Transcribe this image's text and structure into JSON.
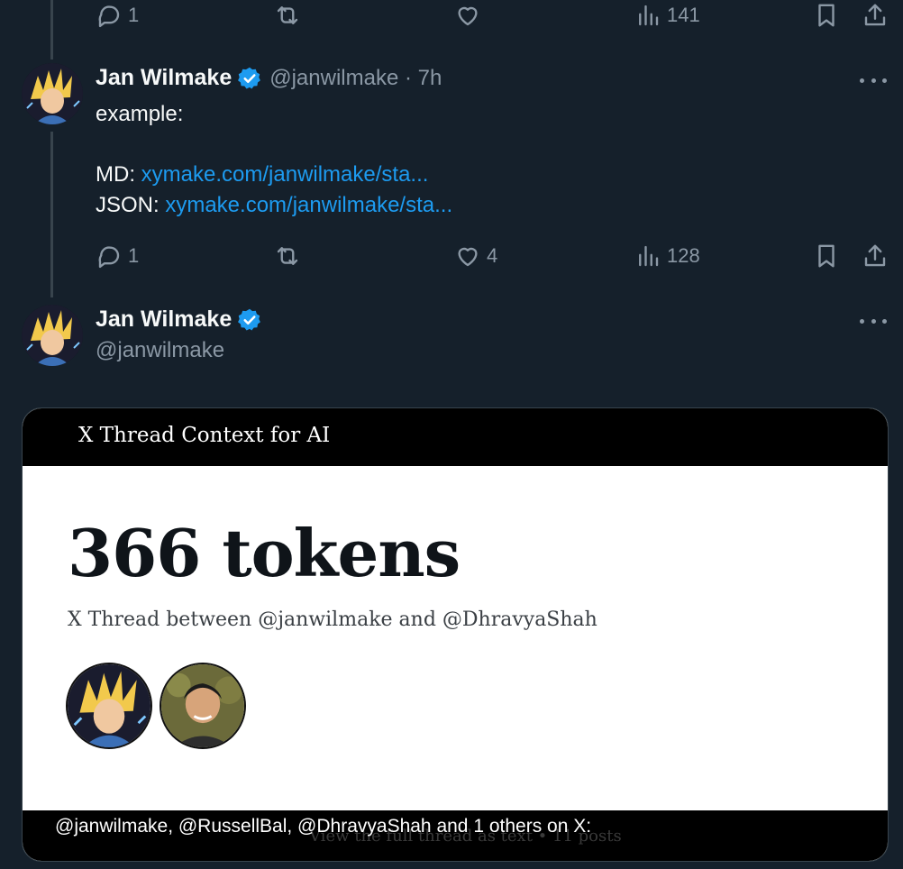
{
  "top_actions": {
    "reply_count": "1",
    "repost_count": "",
    "like_count": "",
    "views_count": "141"
  },
  "post1": {
    "author_name": "Jan Wilmake",
    "handle_time": "@janwilmake · 7h",
    "text_line1": "example:",
    "md_label": "MD: ",
    "md_link": "xymake.com/janwilmake/sta...",
    "json_label": "JSON: ",
    "json_link": "xymake.com/janwilmake/sta...",
    "reply_count": "1",
    "repost_count": "",
    "like_count": "4",
    "views_count": "128"
  },
  "post2": {
    "author_name": "Jan Wilmake",
    "handle": "@janwilmake"
  },
  "card": {
    "header_title": "X Thread Context for AI",
    "tokens": "366 tokens",
    "subtitle": "X Thread between @janwilmake and @DhravyaShah",
    "footer_ghost": "View the full thread as text • 11 posts",
    "footer_text": "@janwilmake, @RussellBal, @DhravyaShah and 1 others on X:"
  },
  "colors": {
    "background": "#15202b",
    "link": "#1d9bf0",
    "muted": "#8b98a5",
    "verified": "#1d9bf0"
  },
  "icons": [
    "reply-icon",
    "repost-icon",
    "like-icon",
    "views-icon",
    "bookmark-icon",
    "share-icon",
    "verified-icon",
    "more-icon"
  ]
}
